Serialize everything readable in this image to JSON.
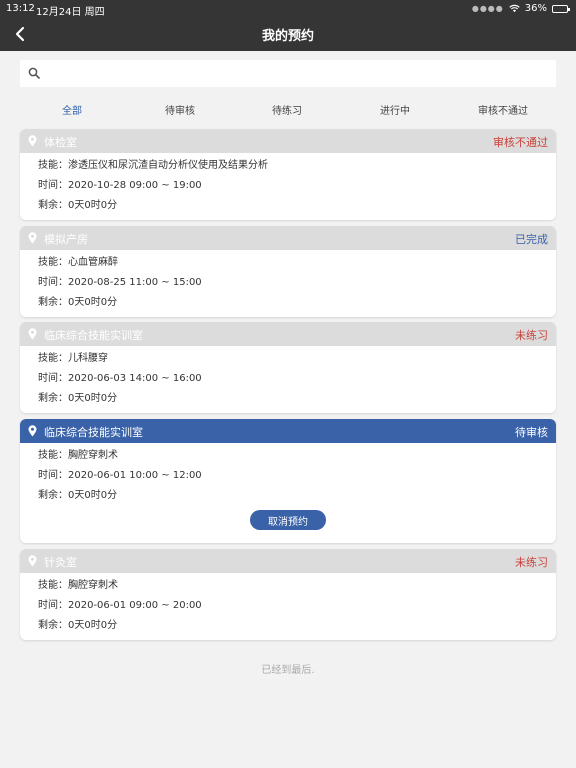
{
  "status_bar": {
    "time": "13:12",
    "date": "12月24日 周四",
    "battery": "36%"
  },
  "nav": {
    "title": "我的预约"
  },
  "search": {
    "placeholder": ""
  },
  "tabs": [
    "全部",
    "待审核",
    "待练习",
    "进行中",
    "审核不通过"
  ],
  "labels": {
    "skill": "技能：",
    "time": "时间：",
    "remain": "剩余："
  },
  "cards": [
    {
      "room": "体检室",
      "status": "审核不通过",
      "skill": "渗透压仪和尿沉渣自动分析仪使用及结果分析",
      "time": "2020-10-28 09:00 ~ 19:00",
      "remain": "0天0时0分"
    },
    {
      "room": "模拟产房",
      "status": "已完成",
      "skill": "心血管麻醉",
      "time": "2020-08-25 11:00 ~ 15:00",
      "remain": "0天0时0分"
    },
    {
      "room": "临床综合技能实训室",
      "status": "未练习",
      "skill": "儿科腰穿",
      "time": "2020-06-03 14:00 ~ 16:00",
      "remain": "0天0时0分"
    },
    {
      "room": "临床综合技能实训室",
      "status": "待审核",
      "skill": "胸腔穿刺术",
      "time": "2020-06-01 10:00 ~ 12:00",
      "remain": "0天0时0分",
      "button": "取消预约"
    },
    {
      "room": "针灸室",
      "status": "未练习",
      "skill": "胸腔穿刺术",
      "time": "2020-06-01 09:00 ~ 20:00",
      "remain": "0天0时0分"
    }
  ],
  "footer": "已经到最后.",
  "colors": {
    "accent": "#3a62a8",
    "danger": "#c9423a",
    "header_bg": "#353535"
  }
}
